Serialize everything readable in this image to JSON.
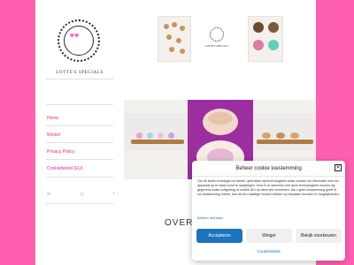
{
  "sidebar": {
    "logo_mark": "♥♥",
    "logo_text": "LOTTE'S SPECIALS",
    "nav": [
      {
        "label": "Home"
      },
      {
        "label": "Winkel"
      },
      {
        "label": "Privacy Policy"
      },
      {
        "label": "Cookiebeleid (EU)"
      }
    ]
  },
  "hero": {
    "mid_label": "LOTTE'S SPECIALS",
    "heading": "OVER"
  },
  "cookie_dialog": {
    "title": "Beheer cookie toestemming",
    "close_icon": "✕",
    "body": "Om de beste ervaringen te bieden, gebruiken wij technologieën zoals cookies om informatie over uw apparaat op te slaan en/of te raadplegen. Door in te stemmen met deze technologieën kunnen wij gegevens zoals surfgedrag of unieke ID's op deze site verwerken. Als u geen toestemming geeft of uw toestemming intrekt, kan dit een nadelige invloed hebben op bepaalde functies en mogelijkheden.",
    "manage_link": "Beheer diensten",
    "accept": "Accepteren",
    "deny": "Weiger",
    "preferences": "Bekijk voorkeuren",
    "footer_link": "Cookiebeleid"
  },
  "colors": {
    "brand_pink": "#ff5fae",
    "link_pink": "#e8298c",
    "accent_blue": "#1e73be"
  }
}
